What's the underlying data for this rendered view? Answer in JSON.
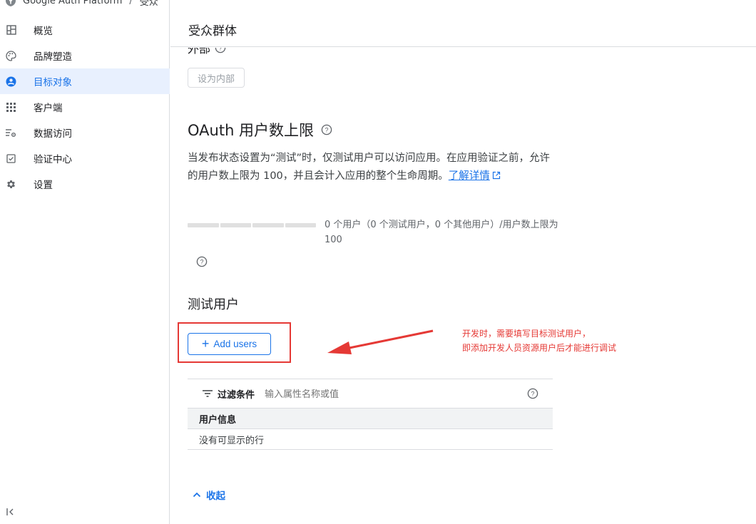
{
  "breadcrumb": {
    "app": "Google Auth Platform",
    "separator": "/",
    "current": "受众"
  },
  "sidebar": {
    "items": [
      {
        "label": "概览",
        "icon": "dashboard-icon"
      },
      {
        "label": "品牌塑造",
        "icon": "palette-icon"
      },
      {
        "label": "目标对象",
        "icon": "person-icon",
        "active": true
      },
      {
        "label": "客户端",
        "icon": "grid-icon"
      },
      {
        "label": "数据访问",
        "icon": "data-access-icon"
      },
      {
        "label": "验证中心",
        "icon": "checkbox-icon"
      },
      {
        "label": "设置",
        "icon": "gear-icon"
      }
    ],
    "collapse_icon": "collapse-sidebar-icon"
  },
  "page": {
    "title": "受众群体"
  },
  "user_type": {
    "heading_partial": "外部",
    "make_internal_label": "设为内部"
  },
  "oauth_limit": {
    "heading": "OAuth 用户数上限",
    "description": "当发布状态设置为“测试”时，仅测试用户可以访问应用。在应用验证之前，允许的用户数上限为 100，并且会计入应用的整个生命周期。",
    "learn_more": "了解详情",
    "usage_text": "0 个用户（0 个测试用户，0 个其他用户）/用户数上限为 100",
    "usage_fraction": 0
  },
  "test_users": {
    "heading": "测试用户",
    "add_label": "Add users",
    "filter_label": "过滤条件",
    "filter_placeholder": "输入属性名称或值",
    "column_header": "用户信息",
    "empty_text": "没有可显示的行",
    "collapse_label": "收起"
  },
  "annotation": {
    "line1": "开发时，需要填写目标测试用户，",
    "line2": "即添加开发人员资源用户后才能进行调试",
    "color": "#e53935"
  },
  "colors": {
    "accent": "#1a73e8",
    "active_bg": "#e8f0fe",
    "annotation": "#e53935"
  }
}
